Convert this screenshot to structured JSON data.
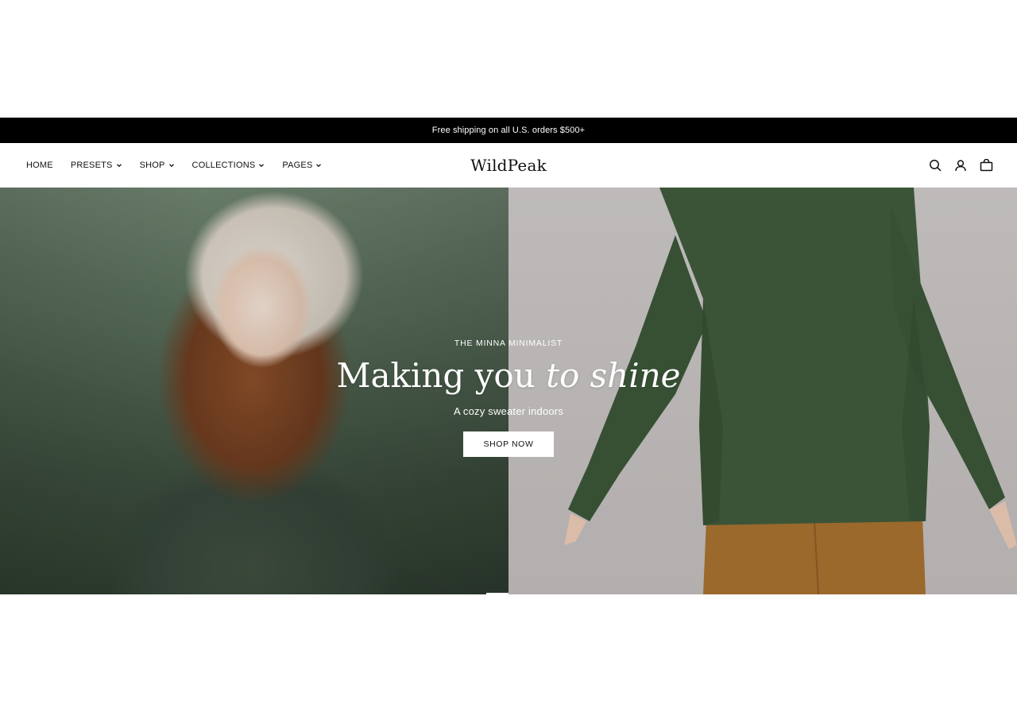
{
  "announcement": {
    "text": "Free shipping on all U.S. orders $500+"
  },
  "header": {
    "nav": [
      {
        "label": "HOME",
        "has_dropdown": false
      },
      {
        "label": "PRESETS",
        "has_dropdown": true
      },
      {
        "label": "SHOP",
        "has_dropdown": true
      },
      {
        "label": "COLLECTIONS",
        "has_dropdown": true
      },
      {
        "label": "PAGES",
        "has_dropdown": true
      }
    ],
    "logo": "WildPeak",
    "icons": [
      "search-icon",
      "account-icon",
      "cart-icon"
    ]
  },
  "hero": {
    "eyebrow": "THE MINNA MINIMALIST",
    "headline_main": "Making you",
    "headline_italic": "to shine",
    "subline": "A cozy sweater indoors",
    "cta_label": "SHOP NOW"
  },
  "colors": {
    "announcement_bg": "#000000",
    "announcement_text": "#ffffff",
    "header_bg": "#ffffff",
    "hero_text": "#ffffff",
    "cta_bg": "#ffffff",
    "sweater_green": "#3f5a3c",
    "pants_tan": "#a5702f"
  }
}
